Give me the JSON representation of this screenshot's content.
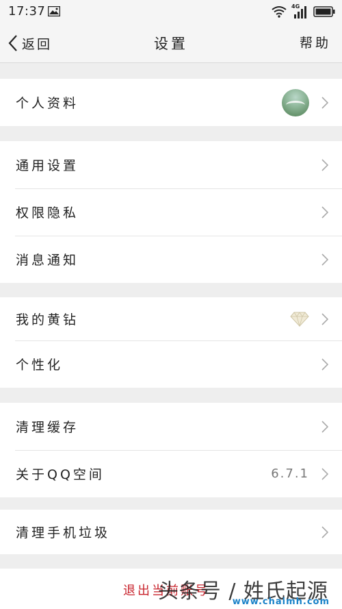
{
  "status_bar": {
    "time": "17:37",
    "network": "4G"
  },
  "nav": {
    "back_label": "返回",
    "title": "设置",
    "help_label": "帮助"
  },
  "groups": [
    {
      "items": [
        {
          "label": "个人资料",
          "avatar": true
        }
      ]
    },
    {
      "items": [
        {
          "label": "通用设置"
        },
        {
          "label": "权限隐私"
        },
        {
          "label": "消息通知"
        }
      ]
    },
    {
      "items": [
        {
          "label": "我的黄钻",
          "icon": "diamond-icon"
        },
        {
          "label": "个性化"
        }
      ]
    },
    {
      "items": [
        {
          "label": "清理缓存"
        },
        {
          "label": "关于QQ空间",
          "value": "6.7.1"
        }
      ]
    },
    {
      "items": [
        {
          "label": "清理手机垃圾"
        }
      ]
    }
  ],
  "footer": {
    "logout_label": "退出当前账号",
    "watermark": "头条号 / 姓氏起源",
    "watermark_url": "www.chaimh.com"
  }
}
